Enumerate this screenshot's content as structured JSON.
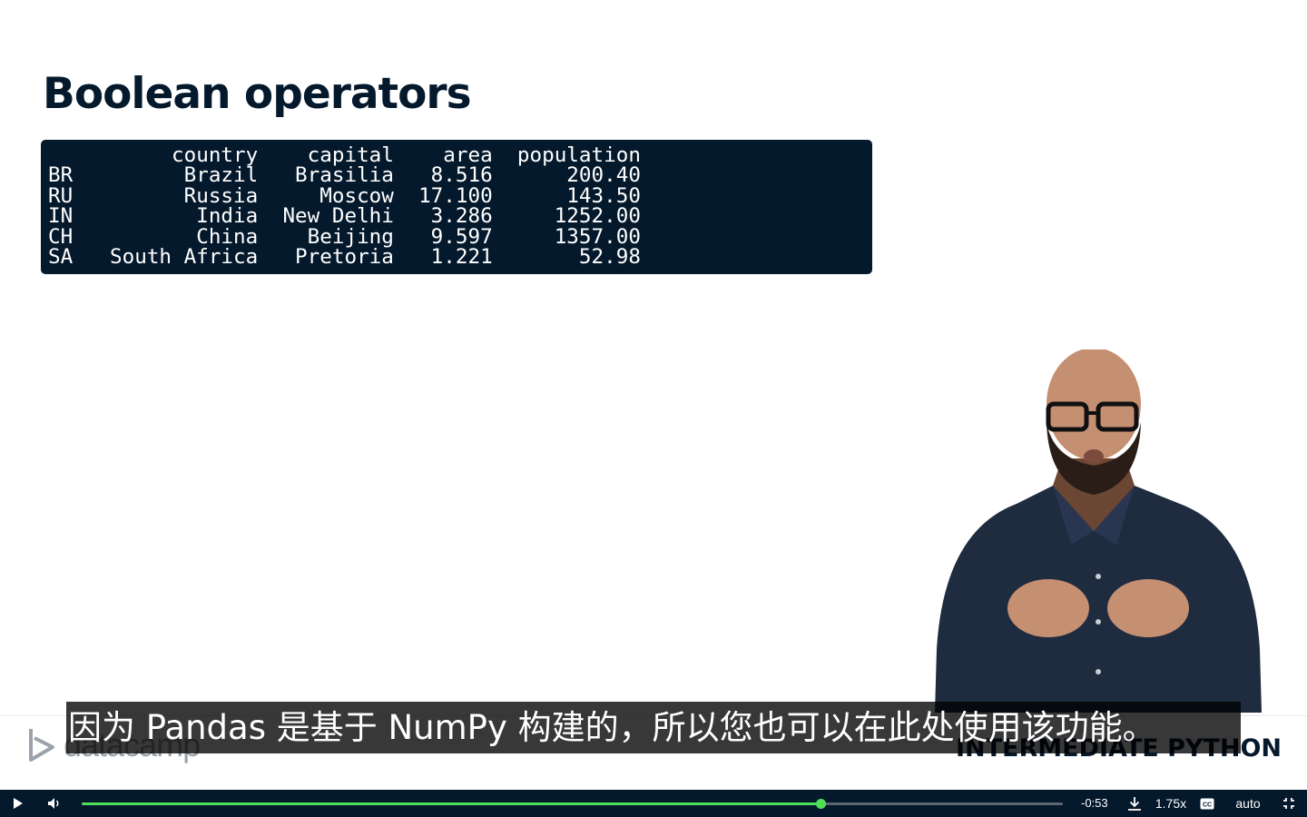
{
  "slide": {
    "title": "Boolean operators",
    "code_output": "          country    capital    area  population\nBR         Brazil   Brasilia   8.516      200.40\nRU         Russia     Moscow  17.100      143.50\nIN          India  New Delhi   3.286     1252.00\nCH          China    Beijing   9.597     1357.00\nSA   South Africa   Pretoria   1.221       52.98"
  },
  "subtitle": "因为 Pandas 是基于 NumPy 构建的，所以您也可以在此处使用该功能。",
  "footer": {
    "brand": "datacamp",
    "course": "INTERMEDIATE PYTHON"
  },
  "player": {
    "remaining_time": "-0:53",
    "speed": "1.75x",
    "quality": "auto",
    "progress_percent": 75.3
  },
  "colors": {
    "navy": "#05192d",
    "progress_green": "#4ee059"
  },
  "icons": [
    "play-icon",
    "volume-icon",
    "download-icon",
    "captions-icon",
    "exit-fullscreen-icon",
    "datacamp-logo-icon"
  ]
}
